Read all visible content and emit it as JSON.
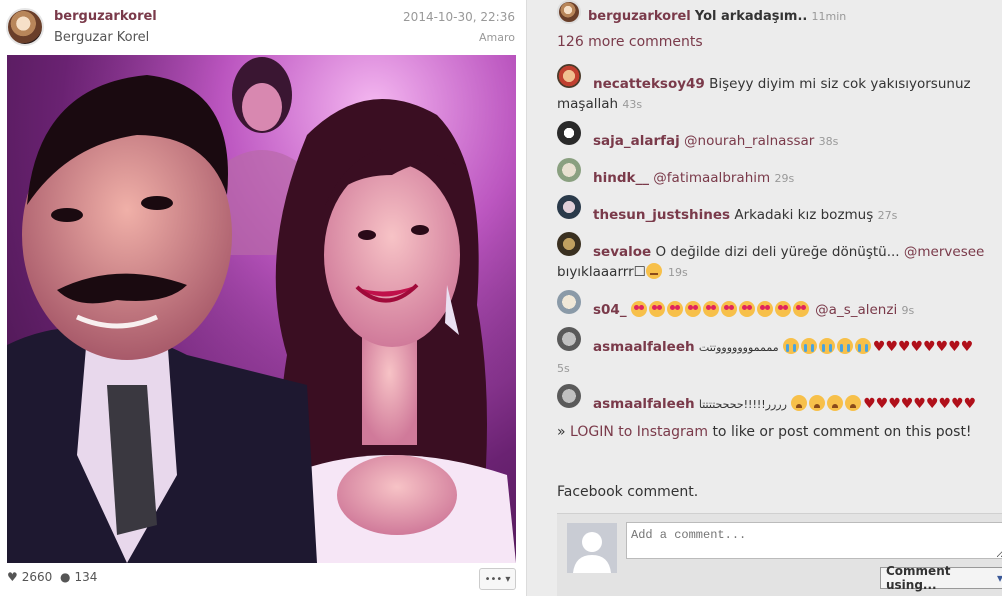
{
  "post": {
    "username": "berguzarkorel",
    "full_name": "Berguzar Korel",
    "date": "2014-10-30, 22:36",
    "filter": "Amaro",
    "likes": "2660",
    "comments": "134",
    "more_menu": "•••"
  },
  "caption": {
    "username": "berguzarkorel",
    "text": "Yol arkadaşım..",
    "time": "11min"
  },
  "more_comments": "126 more comments",
  "comments": [
    {
      "user": "necatteksoy49",
      "text": "Bişeyy diyim mi siz cok yakısıyorsunuz",
      "text2": "maşallah",
      "time": "43s"
    },
    {
      "user": "saja_alarfaj",
      "mention": "@nourah_ralnassar",
      "time": "38s"
    },
    {
      "user": "hindk__",
      "mention": "@fatimaalbrahim",
      "time": "29s"
    },
    {
      "user": "thesun_justshines",
      "text": "Arkadaki kız bozmuş",
      "time": "27s"
    },
    {
      "user": "sevaloe",
      "text": "O değilde dizi deli yüreğe dönüştü...",
      "mention": "@mervesee",
      "text2": "bıyıklaaarrr☐",
      "time": "19s"
    },
    {
      "user": "s04_",
      "mention": "@a_s_alenzi",
      "time": "9s"
    },
    {
      "user": "asmaalfaleeh",
      "text": "مممموووووووتتت",
      "time": "5s"
    },
    {
      "user": "asmaalfaleeh",
      "text": "رررر!!!!!ححححتتتتا"
    }
  ],
  "login": {
    "prefix": "»",
    "link": "LOGIN to Instagram",
    "suffix": "to like or post comment on this post!"
  },
  "facebook": {
    "title": "Facebook comment.",
    "placeholder": "Add a comment...",
    "button": "Comment using..."
  },
  "colors": {
    "username": "#7a3a4a",
    "heart": "#b0101a"
  }
}
